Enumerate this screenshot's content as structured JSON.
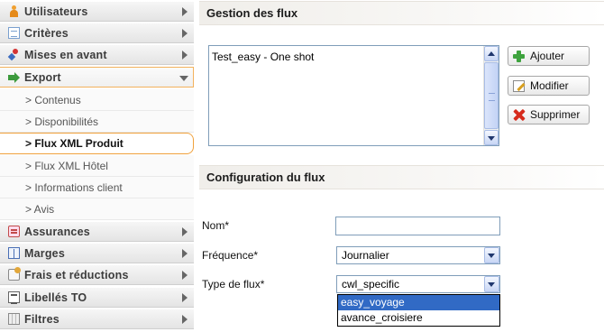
{
  "sidebar": {
    "items": [
      {
        "label": "Utilisateurs",
        "icon": "user-icon"
      },
      {
        "label": "Critères",
        "icon": "document-icon"
      },
      {
        "label": "Mises en avant",
        "icon": "pin-icon"
      },
      {
        "label": "Export",
        "icon": "export-arrow-icon",
        "expanded": true
      },
      {
        "label": "Assurances",
        "icon": "insurance-icon"
      },
      {
        "label": "Marges",
        "icon": "margin-icon"
      },
      {
        "label": "Frais et réductions",
        "icon": "fees-icon"
      },
      {
        "label": "Libellés TO",
        "icon": "labels-icon"
      },
      {
        "label": "Filtres",
        "icon": "filter-icon"
      }
    ],
    "export_subitems": [
      {
        "label": "> Contenus"
      },
      {
        "label": "> Disponibilités"
      },
      {
        "label": "> Flux XML Produit",
        "active": true
      },
      {
        "label": "> Flux XML Hôtel"
      },
      {
        "label": "> Informations client"
      },
      {
        "label": "> Avis"
      }
    ]
  },
  "gestion": {
    "title": "Gestion des flux",
    "list_items": [
      "Test_easy - One shot"
    ],
    "buttons": {
      "add": "Ajouter",
      "edit": "Modifier",
      "delete": "Supprimer"
    }
  },
  "config": {
    "title": "Configuration du flux",
    "nom_label": "Nom*",
    "nom_value": "",
    "frequence_label": "Fréquence*",
    "frequence_value": "Journalier",
    "type_label": "Type de flux*",
    "type_value": "cwl_specific",
    "type_options": [
      "easy_voyage",
      "avance_croisiere"
    ],
    "highlighted_option": "easy_voyage"
  },
  "colors": {
    "active_border": "#f0a13c",
    "selection_bg": "#316ac5",
    "field_border": "#7f9db9"
  }
}
